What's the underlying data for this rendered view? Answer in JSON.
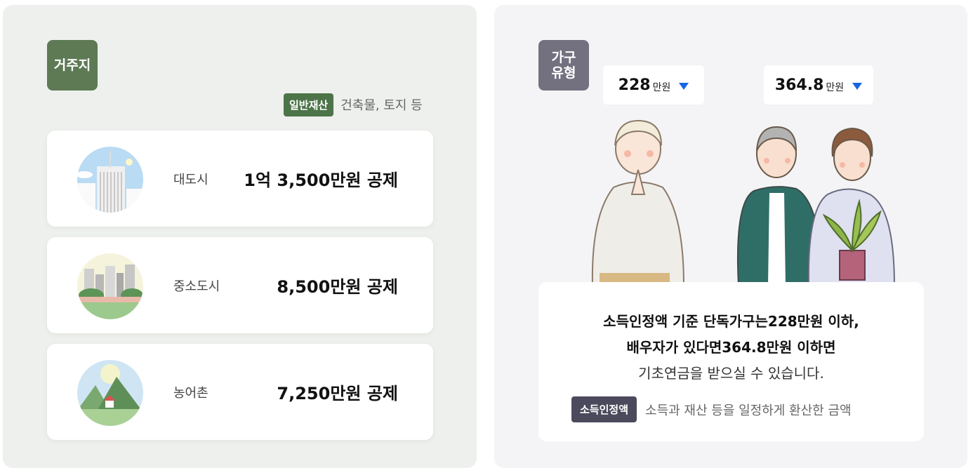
{
  "left": {
    "tag": "거주지",
    "asset_badge": "일반재산",
    "asset_desc": "건축물, 토지 등",
    "rows": [
      {
        "label": "대도시",
        "amount": "1억 3,500만원 공제",
        "icon": "city-skyscraper-icon"
      },
      {
        "label": "중소도시",
        "amount": "8,500만원 공제",
        "icon": "small-city-icon"
      },
      {
        "label": "농어촌",
        "amount": "7,250만원 공제",
        "icon": "rural-mountain-icon"
      }
    ]
  },
  "right": {
    "tag": "가구\n유형",
    "single": {
      "value": "228",
      "unit": "만원"
    },
    "couple": {
      "value": "364.8",
      "unit": "만원"
    },
    "info_lines": [
      "소득인정액 기준 단독가구는228만원 이하,",
      "배우자가 있다면364.8만원 이하면",
      "기초연금을 받으실 수 있습니다."
    ],
    "def_badge": "소득인정액",
    "def_desc": "소득과 재산 등을 일정하게 환산한 금액"
  },
  "colors": {
    "green_tag": "#5e7a55",
    "gray_tag": "#737080",
    "caret_blue": "#1565e8"
  }
}
